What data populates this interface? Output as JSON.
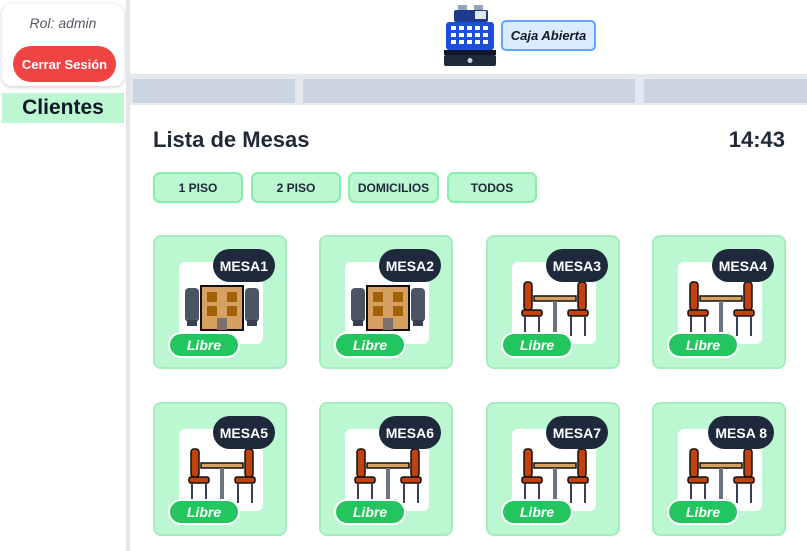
{
  "sidebar": {
    "role": "Rol: admin",
    "logout_label": "Cerrar Sesión",
    "nav_label": "Clientes"
  },
  "header": {
    "register_icon": "cash-register-icon",
    "caja_status": "Caja Abierta"
  },
  "main": {
    "title": "Lista de Mesas",
    "time": "14:43",
    "filters": [
      "1 PISO",
      "2 PISO",
      "DOMICILIOS",
      "TODOS"
    ],
    "tables": [
      {
        "name": "MESA1",
        "status": "Libre",
        "icon": "building-chairs-icon"
      },
      {
        "name": "MESA2",
        "status": "Libre",
        "icon": "building-chairs-icon"
      },
      {
        "name": "MESA3",
        "status": "Libre",
        "icon": "table-chairs-icon"
      },
      {
        "name": "MESA4",
        "status": "Libre",
        "icon": "table-chairs-icon"
      },
      {
        "name": "MESA5",
        "status": "Libre",
        "icon": "table-chairs-icon"
      },
      {
        "name": "MESA6",
        "status": "Libre",
        "icon": "table-chairs-icon"
      },
      {
        "name": "MESA7",
        "status": "Libre",
        "icon": "table-chairs-icon"
      },
      {
        "name": "MESA 8",
        "status": "Libre",
        "icon": "table-chairs-icon"
      }
    ]
  },
  "colors": {
    "accent_green": "#22c55e",
    "card_green": "#bbf7d0",
    "danger_red": "#ef4444",
    "badge_dark": "#1e293b"
  }
}
